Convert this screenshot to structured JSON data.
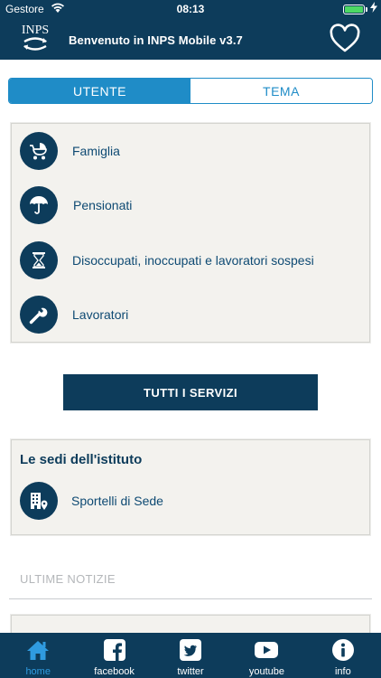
{
  "status": {
    "carrier": "Gestore",
    "time": "08:13"
  },
  "header": {
    "title": "Benvenuto in INPS Mobile v3.7",
    "logo_text": "INPS"
  },
  "segments": [
    {
      "label": "UTENTE",
      "active": true
    },
    {
      "label": "TEMA",
      "active": false
    }
  ],
  "categories": [
    {
      "label": "Famiglia",
      "icon": "stroller-icon"
    },
    {
      "label": "Pensionati",
      "icon": "umbrella-icon"
    },
    {
      "label": "Disoccupati, inoccupati e lavoratori sospesi",
      "icon": "hourglass-icon"
    },
    {
      "label": "Lavoratori",
      "icon": "wrench-icon"
    }
  ],
  "all_services_label": "TUTTI I SERVIZI",
  "sedi": {
    "title": "Le sedi dell'istituto",
    "item_label": "Sportelli di Sede",
    "item_icon": "building-location-icon"
  },
  "news": {
    "label": "ULTIME NOTIZIE"
  },
  "tabs": [
    {
      "label": "home",
      "icon": "home-icon",
      "active": true
    },
    {
      "label": "facebook",
      "icon": "facebook-icon",
      "active": false
    },
    {
      "label": "twitter",
      "icon": "twitter-icon",
      "active": false
    },
    {
      "label": "youtube",
      "icon": "youtube-icon",
      "active": false
    },
    {
      "label": "info",
      "icon": "info-icon",
      "active": false
    }
  ],
  "colors": {
    "primary": "#0d3c5b",
    "accent": "#1f8cc7",
    "card_bg": "#f3f2ee",
    "battery": "#4cd964",
    "tab_active": "#2f9be0"
  }
}
